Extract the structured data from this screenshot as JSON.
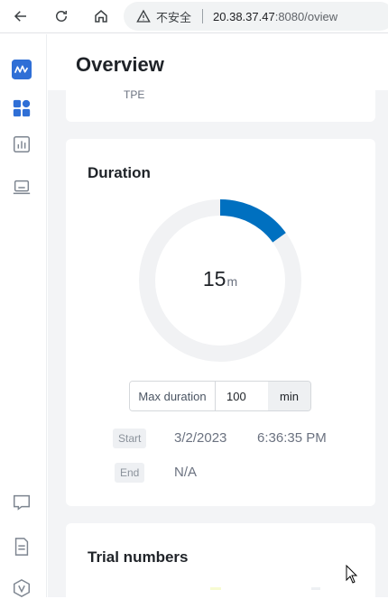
{
  "browser": {
    "security_label": "不安全",
    "url_host": "20.38.37.47",
    "url_rest": ":8080/oview"
  },
  "sidebar": {
    "items": [
      {
        "icon": "logo-icon"
      },
      {
        "icon": "dashboard-icon"
      },
      {
        "icon": "bar-chart-icon"
      },
      {
        "icon": "laptop-icon"
      },
      {
        "icon": "chat-icon"
      },
      {
        "icon": "document-icon"
      },
      {
        "icon": "v-badge-icon"
      }
    ]
  },
  "page": {
    "title": "Overview"
  },
  "top_card": {
    "airport_code": "TPE"
  },
  "duration": {
    "title": "Duration",
    "value": "15",
    "unit": "m",
    "progress_fraction": 0.15,
    "max_label": "Max duration",
    "max_value": "100",
    "max_unit": "min",
    "start_label": "Start",
    "start_date": "3/2/2023",
    "start_time": "6:36:35 PM",
    "end_label": "End",
    "end_value": "N/A"
  },
  "trial": {
    "title": "Trial numbers"
  },
  "colors": {
    "accent": "#0070c0",
    "ring_track": "#f1f2f4",
    "logo_bg": "#2f6fd6"
  }
}
